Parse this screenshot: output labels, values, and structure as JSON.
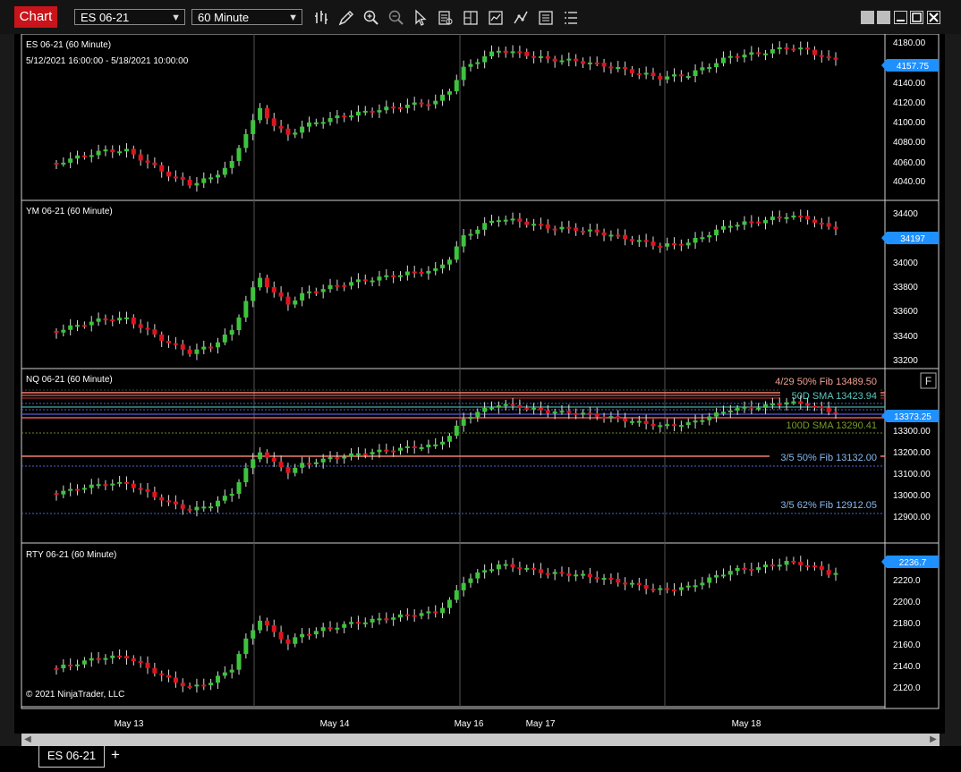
{
  "toolbar": {
    "title": "Chart",
    "instrument": "ES 06-21",
    "interval": "60 Minute",
    "icons": [
      "bars-type-icon",
      "drawing-pencil-icon",
      "zoom-in-icon",
      "zoom-out-icon",
      "pointer-icon",
      "data-box-icon",
      "chart-trader-icon",
      "strategies-icon",
      "indicators-icon",
      "properties-icon",
      "list-icon"
    ],
    "window_buttons": [
      "tile-icon",
      "tile-icon",
      "minimize-icon",
      "maximize-icon",
      "close-icon"
    ]
  },
  "colors": {
    "up": "#3cc43c",
    "down": "#e0141e",
    "price_marker": "#1e90ff",
    "fib": "#f08070",
    "sma50": "#4aa8a0",
    "sma100": "#6a8a2a",
    "fib_low": "#6aa0e0"
  },
  "panels": [
    {
      "title": "ES 06-21 (60 Minute)",
      "date_range": "5/12/2021 16:00:00 - 5/18/2021 10:00:00",
      "y_ticks": [
        "4180.00",
        "4160.00",
        "4140.00",
        "4120.00",
        "4100.00",
        "4080.00",
        "4060.00",
        "4040.00"
      ],
      "price_label": "4157.75"
    },
    {
      "title": "YM 06-21 (60 Minute)",
      "y_ticks": [
        "34400",
        "34200",
        "34000",
        "33800",
        "33600",
        "33400",
        "33200"
      ],
      "price_label": "34197"
    },
    {
      "title": "NQ 06-21 (60 Minute)",
      "y_ticks": [
        "13300.00",
        "13200.00",
        "13100.00",
        "13000.00",
        "12900.00"
      ],
      "price_label": "13373.25",
      "lines": [
        {
          "label": "4/29 50% Fib 13489.50",
          "color": "fib"
        },
        {
          "label": "50D SMA 13423.94",
          "color": "sma50"
        },
        {
          "label": "100D SMA 13290.41",
          "color": "sma100"
        },
        {
          "label": "3/5 50% Fib 13132.00",
          "color": "fib_low"
        },
        {
          "label": "3/5 62% Fib 12912.05",
          "color": "fib_low"
        }
      ],
      "badge": "F"
    },
    {
      "title": "RTY 06-21 (60 Minute)",
      "y_ticks": [
        "2220.0",
        "2200.0",
        "2180.0",
        "2160.0",
        "2140.0",
        "2120.0"
      ],
      "price_label": "2236.7",
      "copyright": "© 2021 NinjaTrader, LLC"
    }
  ],
  "x_axis": [
    "May 13",
    "May 14",
    "May 16",
    "May 17",
    "May 18"
  ],
  "tabs": [
    {
      "label": "ES 06-21"
    }
  ],
  "add_tab": "+"
}
